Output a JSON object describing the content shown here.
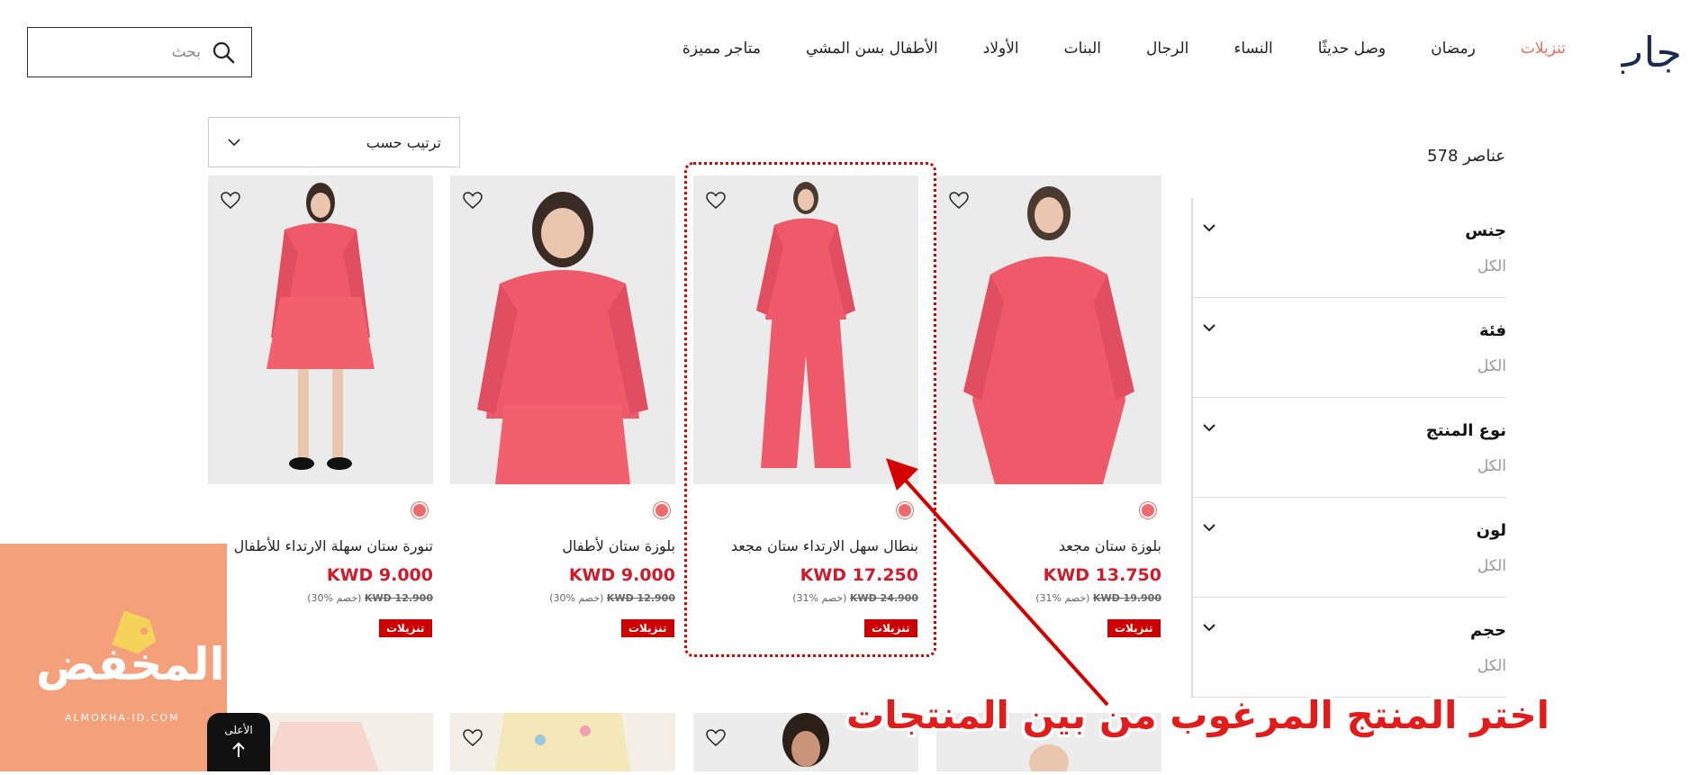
{
  "header": {
    "logo_text": "جاب",
    "nav": [
      "تنزيلات",
      "رمضان",
      "وصل حديثًا",
      "النساء",
      "الرجال",
      "البنات",
      "الأولاد",
      "الأطفال بسن المشي",
      "متاجر مميزة"
    ],
    "search_placeholder": "بحث"
  },
  "toolbar": {
    "sort_label": "ترتيب حسب"
  },
  "results": {
    "count": "578 عناصر"
  },
  "filters": [
    {
      "title": "جنس",
      "value": "الكل"
    },
    {
      "title": "فئة",
      "value": "الكل"
    },
    {
      "title": "نوع المنتج",
      "value": "الكل"
    },
    {
      "title": "لون",
      "value": "الكل"
    },
    {
      "title": "حجم",
      "value": "الكل"
    }
  ],
  "products": [
    {
      "name": "بلوزة ستان مجعد",
      "price": "KWD 13.750",
      "old_price": "KWD 19.900",
      "discount": "(31% خصم)",
      "badge": "تنزيلات"
    },
    {
      "name": "بنطال سهل الارتداء ستان مجعد",
      "price": "KWD 17.250",
      "old_price": "KWD 24.900",
      "discount": "(31% خصم)",
      "badge": "تنزيلات"
    },
    {
      "name": "بلوزة ستان لأطفال",
      "price": "KWD 9.000",
      "old_price": "KWD 12.900",
      "discount": "(30% خصم)",
      "badge": "تنزيلات"
    },
    {
      "name": "تنورة ستان سهلة الارتداء للأطفال",
      "price": "KWD 9.000",
      "old_price": "KWD 12.900",
      "discount": "(30% خصم)",
      "badge": "تنزيلات"
    }
  ],
  "annotation": "اختر المنتج المرغوب من بين المنتجات",
  "watermark": {
    "text": "المخفض",
    "sub": "ALMOKHA-ID.COM"
  },
  "back_to_top": "الأعلى",
  "colors": {
    "accent": "#ef6b5a",
    "price": "#d11a2a",
    "badge": "#cc0000",
    "swatch": "#f0696c",
    "watermark_bg": "#f4a07a"
  }
}
